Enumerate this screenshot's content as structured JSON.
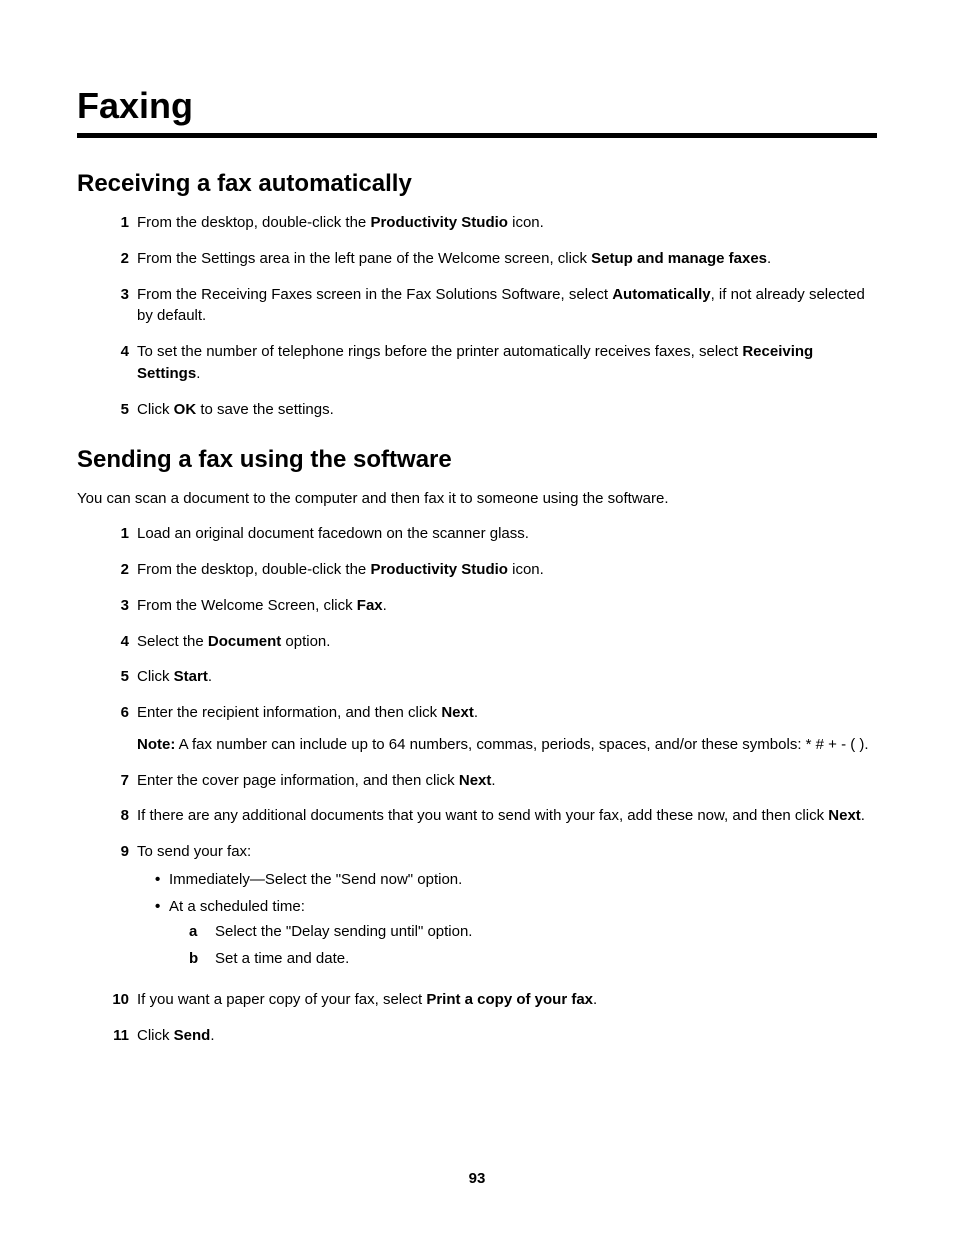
{
  "chapter": "Faxing",
  "sections": {
    "receiving": {
      "title": "Receiving a fax automatically",
      "steps": [
        {
          "n": "1",
          "html": "From the desktop, double-click the <b>Productivity Studio</b> icon."
        },
        {
          "n": "2",
          "html": "From the Settings area in the left pane of the Welcome screen, click <b>Setup and manage faxes</b>."
        },
        {
          "n": "3",
          "html": "From the Receiving Faxes screen in the Fax Solutions Software, select <b>Automatically</b>, if not already selected by default."
        },
        {
          "n": "4",
          "html": "To set the number of telephone rings before the printer automatically receives faxes, select <b>Receiving Settings</b>."
        },
        {
          "n": "5",
          "html": "Click <b>OK</b> to save the settings."
        }
      ]
    },
    "sending": {
      "title": "Sending a fax using the software",
      "intro": "You can scan a document to the computer and then fax it to someone using the software.",
      "steps": [
        {
          "n": "1",
          "html": "Load an original document facedown on the scanner glass."
        },
        {
          "n": "2",
          "html": "From the desktop, double-click the <b>Productivity Studio</b> icon."
        },
        {
          "n": "3",
          "html": "From the Welcome Screen, click <b>Fax</b>."
        },
        {
          "n": "4",
          "html": "Select the <b>Document</b> option."
        },
        {
          "n": "5",
          "html": "Click <b>Start</b>."
        },
        {
          "n": "6",
          "html": "Enter the recipient information, and then click <b>Next</b>.",
          "extra": "<b>Note:</b> A fax number can include up to 64 numbers, commas, periods, spaces, and/or these symbols: * # + - ( )."
        },
        {
          "n": "7",
          "html": "Enter the cover page information, and then click <b>Next</b>."
        },
        {
          "n": "8",
          "html": "If there are any additional documents that you want to send with your fax, add these now, and then click <b>Next</b>."
        },
        {
          "n": "9",
          "html": "To send your fax:",
          "bullets": [
            {
              "html": "Immediately—Select the \"Send now\" option."
            },
            {
              "html": "At a scheduled time:",
              "alpha": [
                {
                  "m": "a",
                  "html": "Select the \"Delay sending until\" option."
                },
                {
                  "m": "b",
                  "html": "Set a time and date."
                }
              ]
            }
          ]
        },
        {
          "n": "10",
          "html": "If you want a paper copy of your fax, select <b>Print a copy of your fax</b>."
        },
        {
          "n": "11",
          "html": "Click <b>Send</b>."
        }
      ]
    }
  },
  "page_number": "93"
}
